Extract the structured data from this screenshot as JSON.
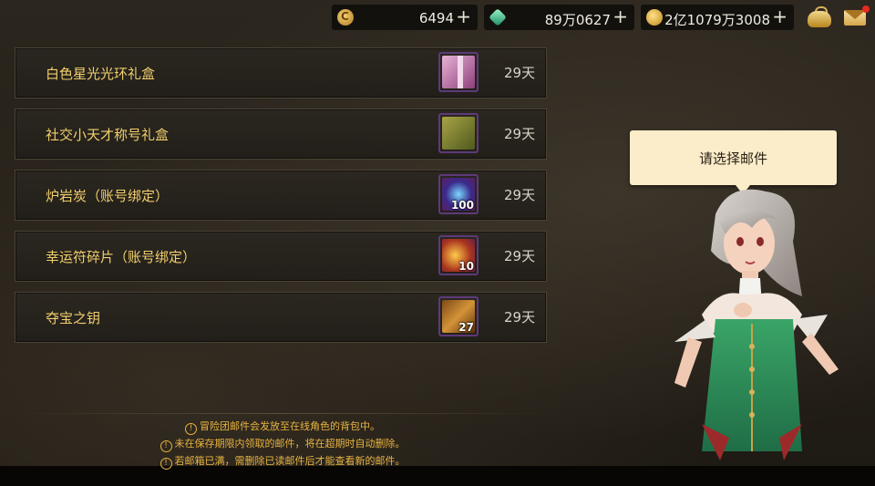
{
  "currencies": [
    {
      "icon": "cera-coin-icon",
      "value": "6494",
      "plus": "+"
    },
    {
      "icon": "green-gem-icon",
      "value": "89万0627",
      "plus": "+"
    },
    {
      "icon": "gold-coin-icon",
      "value": "2亿1079万3008",
      "plus": "+"
    }
  ],
  "top_icons": [
    "bag-icon",
    "mail-icon"
  ],
  "mails": [
    {
      "title": "白色星光光环礼盒",
      "icon": "gift-box-icon",
      "count": "",
      "days": "29天"
    },
    {
      "title": "社交小天才称号礼盒",
      "icon": "title-box-icon",
      "count": "",
      "days": "29天"
    },
    {
      "title": "炉岩炭（账号绑定）",
      "icon": "coal-icon",
      "count": "100",
      "days": "29天"
    },
    {
      "title": "幸运符碎片（账号绑定）",
      "icon": "lucky-charm-icon",
      "count": "10",
      "days": "29天"
    },
    {
      "title": "夺宝之钥",
      "icon": "treasure-key-icon",
      "count": "27",
      "days": "29天"
    }
  ],
  "notes": [
    "冒险团邮件会发放至在线角色的背包中。",
    "未在保存期限内领取的邮件，将在超期时自动删除。",
    "若邮箱已满，需删除已读邮件后才能查看新的邮件。"
  ],
  "bubble": {
    "text": "请选择邮件"
  },
  "colors": {
    "title": "#f2cf6d",
    "note": "#e7b340",
    "bubble": "#fbedc9"
  }
}
